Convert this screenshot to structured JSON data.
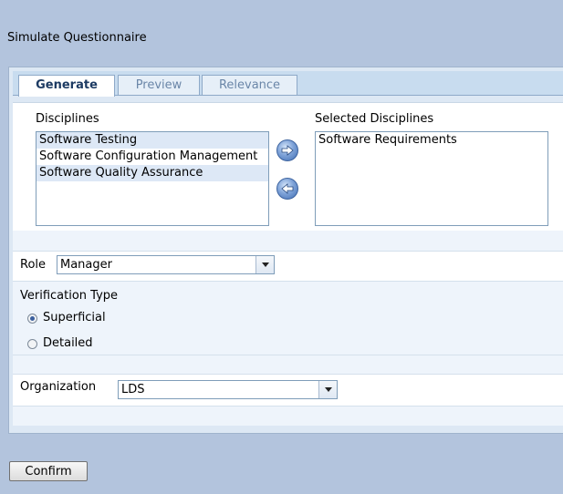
{
  "title": "Simulate Questionnaire",
  "tabs": [
    "Generate",
    "Preview",
    "Relevance"
  ],
  "disciplines": {
    "label": "Disciplines",
    "items": [
      "Software Testing",
      "Software Configuration Management",
      "Software Quality Assurance"
    ]
  },
  "selected": {
    "label": "Selected Disciplines",
    "items": [
      "Software Requirements"
    ]
  },
  "role": {
    "label": "Role",
    "value": "Manager"
  },
  "verification": {
    "label": "Verification Type",
    "options": [
      "Superficial",
      "Detailed"
    ],
    "selected": "Superficial"
  },
  "organization": {
    "label": "Organization",
    "value": "LDS"
  },
  "confirm_label": "Confirm",
  "icons": {
    "add": "arrow-right-icon",
    "remove": "arrow-left-icon",
    "dropdown": "chevron-down-icon"
  }
}
